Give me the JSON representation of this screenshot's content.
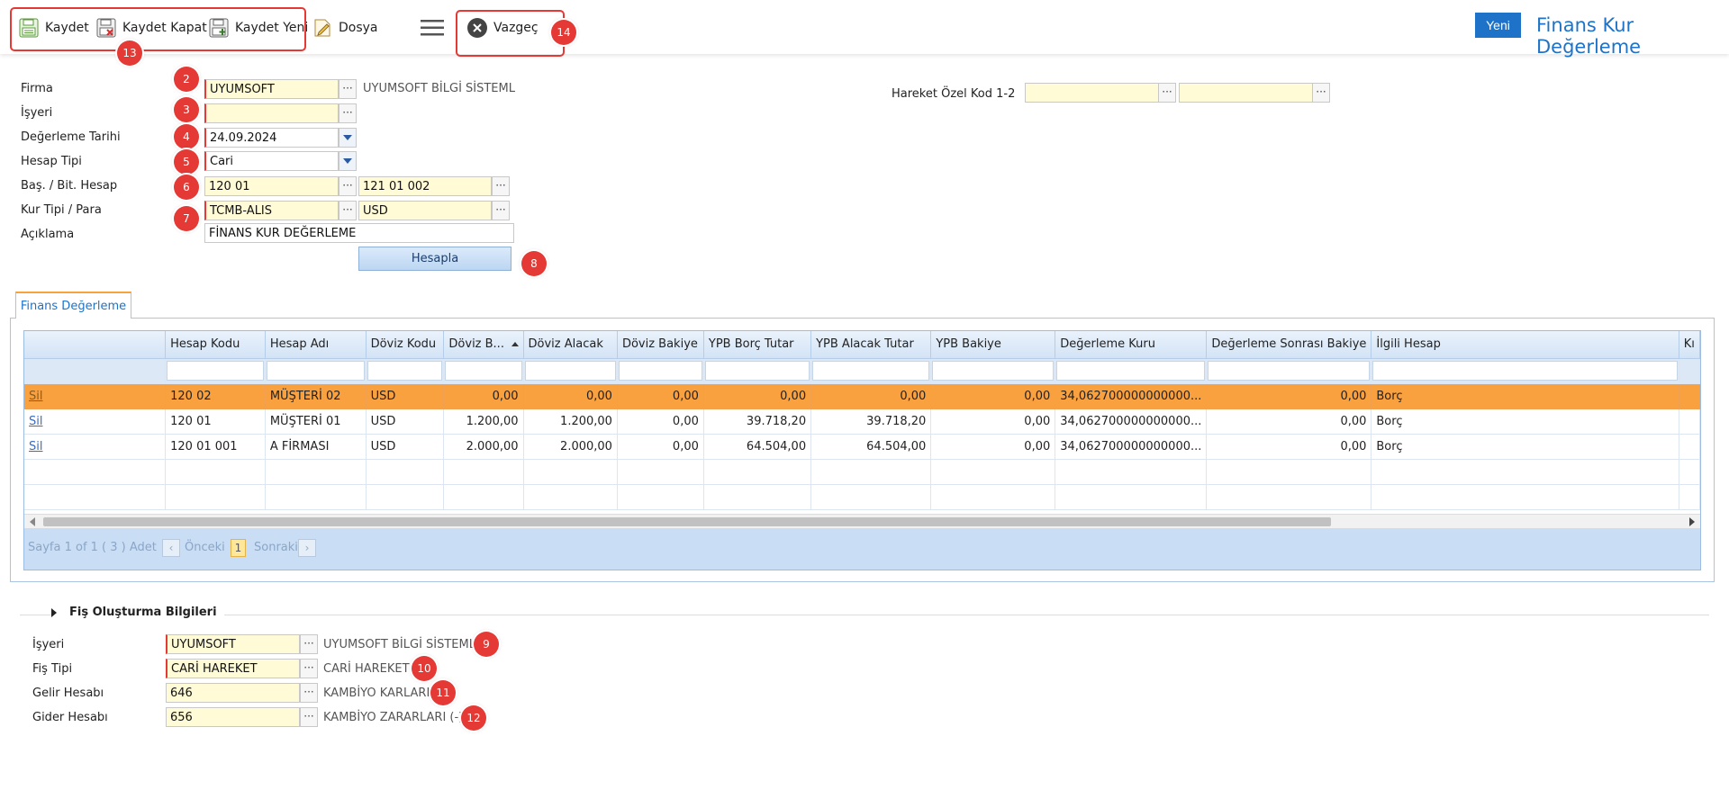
{
  "toolbar": {
    "save": "Kaydet",
    "save_close": "Kaydet Kapat",
    "save_new": "Kaydet Yeni",
    "file": "Dosya",
    "cancel": "Vazgeç"
  },
  "header": {
    "new_button": "Yeni",
    "title": "Finans Kur Değerleme"
  },
  "annotations": [
    "2",
    "3",
    "4",
    "5",
    "6",
    "7",
    "8",
    "9",
    "10",
    "11",
    "12",
    "13",
    "14"
  ],
  "form": {
    "firma": {
      "label": "Firma",
      "value": "UYUMSOFT",
      "desc": "UYUMSOFT BİLGİ SİSTEML"
    },
    "isyeri": {
      "label": "İşyeri",
      "value": ""
    },
    "degerleme_tarihi": {
      "label": "Değerleme Tarihi",
      "value": "24.09.2024"
    },
    "hesap_tipi": {
      "label": "Hesap Tipi",
      "value": "Cari"
    },
    "bas_bit_hesap": {
      "label": "Baş. / Bit. Hesap",
      "start": "120 01",
      "end": "121 01 002"
    },
    "kur_tipi_para": {
      "label": "Kur Tipi / Para",
      "kur": "TCMB-ALIS",
      "para": "USD"
    },
    "aciklama": {
      "label": "Açıklama",
      "value": "FİNANS KUR DEĞERLEME"
    },
    "hesapla": "Hesapla",
    "hareket_ozel_kod": {
      "label": "Hareket Özel Kod 1-2",
      "value1": "",
      "value2": ""
    }
  },
  "tab": {
    "label": "Finans Değerleme"
  },
  "grid": {
    "columns": [
      "",
      "Hesap Kodu",
      "Hesap Adı",
      "Döviz Kodu",
      "Döviz B...",
      "Döviz Alacak",
      "Döviz Bakiye",
      "YPB Borç Tutar",
      "YPB Alacak Tutar",
      "YPB Bakiye",
      "Değerleme Kuru",
      "Değerleme Sonrası Bakiye",
      "İlgili Hesap",
      "Kı"
    ],
    "rows": [
      [
        "Sil",
        "120 02",
        "MÜŞTERİ 02",
        "USD",
        "0,00",
        "0,00",
        "0,00",
        "0,00",
        "0,00",
        "0,00",
        "34,062700000000000...",
        "0,00",
        "Borç",
        ""
      ],
      [
        "Sil",
        "120 01",
        "MÜŞTERİ 01",
        "USD",
        "1.200,00",
        "1.200,00",
        "0,00",
        "39.718,20",
        "39.718,20",
        "0,00",
        "34,062700000000000...",
        "0,00",
        "Borç",
        ""
      ],
      [
        "Sil",
        "120 01 001",
        "A FİRMASI",
        "USD",
        "2.000,00",
        "2.000,00",
        "0,00",
        "64.504,00",
        "64.504,00",
        "0,00",
        "34,062700000000000...",
        "0,00",
        "Borç",
        ""
      ]
    ],
    "pager": {
      "info": "Sayfa 1 of 1 ( 3 ) Adet",
      "prev": "Önceki",
      "page": "1",
      "next": "Sonraki"
    }
  },
  "fis": {
    "section_title": "Fiş Oluşturma Bilgileri",
    "isyeri": {
      "label": "İşyeri",
      "value": "UYUMSOFT",
      "desc": "UYUMSOFT BİLGİ SİSTEML"
    },
    "fis_tipi": {
      "label": "Fiş Tipi",
      "value": "CARİ HAREKET",
      "desc": "CARİ HAREKET"
    },
    "gelir_hesabi": {
      "label": "Gelir Hesabı",
      "value": "646",
      "desc": "KAMBİYO KARLARI"
    },
    "gider_hesabi": {
      "label": "Gider Hesabı",
      "value": "656",
      "desc": "KAMBİYO ZARARLARI (-)"
    }
  },
  "colors": {
    "accent": "#1e73c8",
    "selected_row": "#f9a03f",
    "required_field": "#fffbd6",
    "annotation": "#e53935"
  },
  "icons": [
    "save-icon",
    "save-close-icon",
    "save-new-icon",
    "file-edit-icon",
    "hamburger-menu-icon",
    "close-circle-icon",
    "ellipsis-icon",
    "dropdown-arrow-icon",
    "sort-asc-icon",
    "chevron-left-icon",
    "chevron-right-icon",
    "expand-triangle-icon"
  ]
}
